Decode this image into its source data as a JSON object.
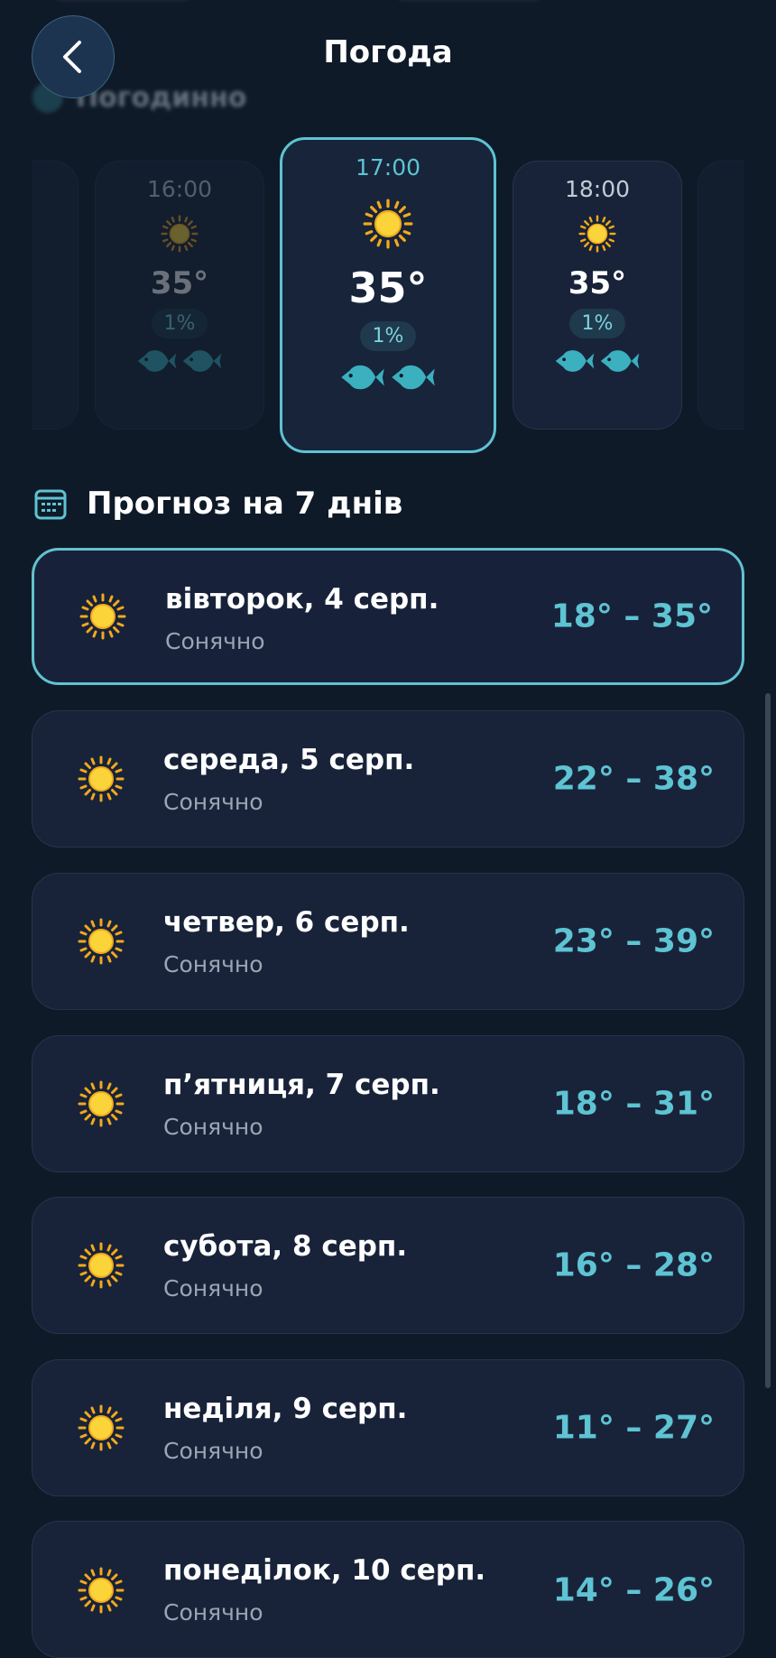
{
  "header": {
    "title": "Погода"
  },
  "hourly_section": {
    "title": "Погодинно"
  },
  "hourly": [
    {
      "time": "16:00",
      "temp": "35°",
      "precip": "1%"
    },
    {
      "time": "17:00",
      "temp": "35°",
      "precip": "1%"
    },
    {
      "time": "18:00",
      "temp": "35°",
      "precip": "1%"
    }
  ],
  "forecast": {
    "title": "Прогноз на 7 днів",
    "days": [
      {
        "name": "вівторок, 4 серп.",
        "condition": "Сонячно",
        "range": "18° – 35°"
      },
      {
        "name": "середа, 5 серп.",
        "condition": "Сонячно",
        "range": "22° – 38°"
      },
      {
        "name": "четвер, 6 серп.",
        "condition": "Сонячно",
        "range": "23° – 39°"
      },
      {
        "name": "п’ятниця, 7 серп.",
        "condition": "Сонячно",
        "range": "18° – 31°"
      },
      {
        "name": "субота, 8 серп.",
        "condition": "Сонячно",
        "range": "16° – 28°"
      },
      {
        "name": "неділя, 9 серп.",
        "condition": "Сонячно",
        "range": "11° – 27°"
      },
      {
        "name": "понеділок, 10 серп.",
        "condition": "Сонячно",
        "range": "14° – 26°"
      }
    ]
  },
  "colors": {
    "accent": "#5ec3d2",
    "background": "#0f1a28",
    "card": "#18233a",
    "sun": "#f7c52b"
  },
  "icons": {
    "back": "chevron-left-icon",
    "calendar": "calendar-icon",
    "sun": "sun-icon",
    "fish": "fish-icon"
  }
}
